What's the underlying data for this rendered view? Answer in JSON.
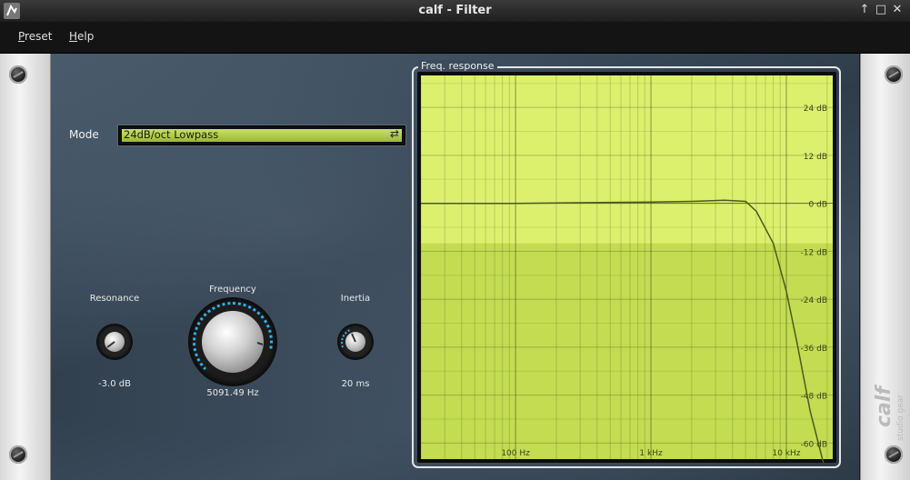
{
  "window": {
    "title": "calf - Filter",
    "controls": [
      "↑",
      "□",
      "✕"
    ]
  },
  "menu": {
    "preset_mnemonic": "P",
    "preset_rest": "reset",
    "help_mnemonic": "H",
    "help_rest": "elp"
  },
  "mode": {
    "label": "Mode",
    "value": "24dB/oct Lowpass",
    "arrows_icon": "swap-arrows-icon"
  },
  "knobs": {
    "resonance": {
      "label": "Resonance",
      "value": "-3.0 dB"
    },
    "frequency": {
      "label": "Frequency",
      "value": "5091.49 Hz"
    },
    "inertia": {
      "label": "Inertia",
      "value": "20 ms"
    }
  },
  "freq_response": {
    "title": "Freq. response",
    "db_labels": [
      "24 dB",
      "12 dB",
      "0 dB",
      "-12 dB",
      "-24 dB",
      "-36 dB",
      "-48 dB",
      "-60 dB"
    ],
    "hz_labels": [
      "100 Hz",
      "1 kHz",
      "10 kHz"
    ]
  },
  "chart_data": {
    "type": "line",
    "x": [
      20,
      100,
      1000,
      2000,
      3500,
      5000,
      6000,
      8000,
      10000,
      12000,
      15000,
      20000
    ],
    "y": [
      0,
      0,
      0.3,
      0.5,
      0.8,
      0.5,
      -2,
      -10,
      -22,
      -35,
      -52,
      -72
    ],
    "xlim": [
      20,
      22000
    ],
    "ylim": [
      -64,
      32
    ],
    "x_scale": "log",
    "grid": true
  },
  "colors": {
    "graph_bg": "#dcf06e",
    "graph_bg_low": "#c3dc52",
    "curve": "#4b5a1e",
    "accent_led": "#29b3f0"
  }
}
